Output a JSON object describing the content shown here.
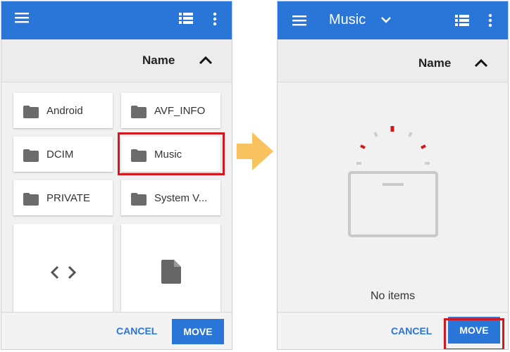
{
  "left_screen": {
    "sort_label": "Name",
    "folders": [
      "Android",
      "AVF_INFO",
      "DCIM",
      "Music",
      "PRIVATE",
      "System V..."
    ],
    "cancel_label": "CANCEL",
    "move_label": "MOVE",
    "icons": [
      "menu-icon",
      "list-view-icon",
      "more-vert-icon",
      "chevron-up-icon",
      "folder-icon",
      "code-icon",
      "file-icon"
    ]
  },
  "right_screen": {
    "title": "Music",
    "sort_label": "Name",
    "empty_text": "No items",
    "cancel_label": "CANCEL",
    "move_label": "MOVE",
    "icons": [
      "menu-icon",
      "dropdown-arrow-icon",
      "list-view-icon",
      "more-vert-icon",
      "chevron-up-icon",
      "empty-tray-icon"
    ]
  },
  "colors": {
    "accent": "#2a75d8",
    "highlight": "#d2181e",
    "arrow": "#f8c25e"
  }
}
